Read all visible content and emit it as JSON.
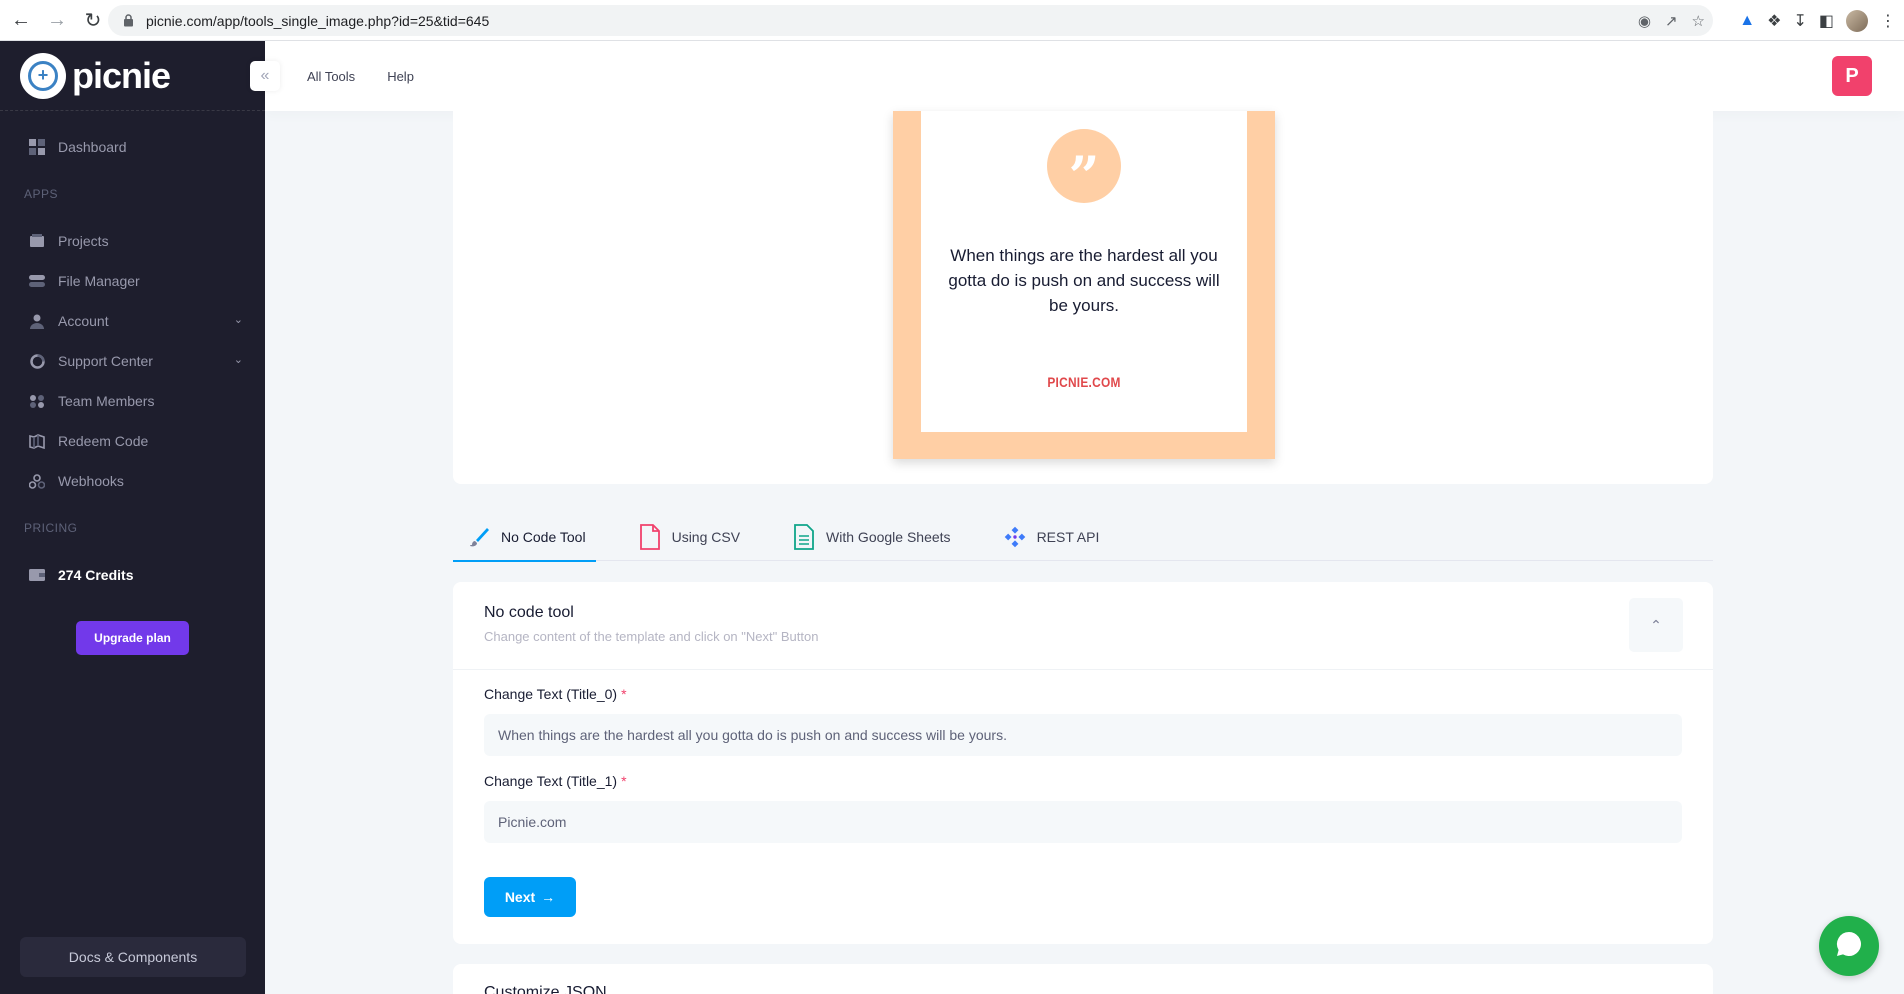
{
  "browser": {
    "url": "picnie.com/app/tools_single_image.php?id=25&tid=645"
  },
  "sidebar": {
    "brand": "picnie",
    "dashboard": "Dashboard",
    "apps_heading": "APPS",
    "apps": [
      {
        "label": "Projects",
        "icon": "projects-icon"
      },
      {
        "label": "File Manager",
        "icon": "file-manager-icon"
      },
      {
        "label": "Account",
        "icon": "account-icon",
        "expandable": true
      },
      {
        "label": "Support Center",
        "icon": "support-icon",
        "expandable": true
      },
      {
        "label": "Team Members",
        "icon": "team-icon"
      },
      {
        "label": "Redeem Code",
        "icon": "redeem-icon"
      },
      {
        "label": "Webhooks",
        "icon": "webhooks-icon"
      }
    ],
    "pricing_heading": "PRICING",
    "credits": "274 Credits",
    "upgrade_label": "Upgrade plan",
    "docs_label": "Docs & Components"
  },
  "header": {
    "links": [
      "All Tools",
      "Help"
    ],
    "avatar_letter": "P"
  },
  "preview": {
    "quote": "When things are the hardest all you gotta do is push on and success will be yours.",
    "brand": "PICNIE.COM",
    "quote_glyph": "”"
  },
  "tabs": [
    {
      "label": "No Code Tool",
      "active": true
    },
    {
      "label": "Using CSV",
      "active": false
    },
    {
      "label": "With Google Sheets",
      "active": false
    },
    {
      "label": "REST API",
      "active": false
    }
  ],
  "form": {
    "title": "No code tool",
    "subtitle": "Change content of the template and click on \"Next\" Button",
    "fields": [
      {
        "label": "Change Text (Title_0)",
        "value": "When things are the hardest all you gotta do is push on and success will be yours."
      },
      {
        "label": "Change Text (Title_1)",
        "value": "Picnie.com"
      }
    ],
    "required_mark": "*",
    "next_label": "Next"
  },
  "customize": {
    "title": "Customize JSON"
  },
  "colors": {
    "sidebar_bg": "#1e1e2d",
    "primary": "#009ef7",
    "upgrade": "#7239ea",
    "avatar": "#f1416c",
    "poster_frame": "#ffcfa5",
    "chat": "#21b04b"
  }
}
